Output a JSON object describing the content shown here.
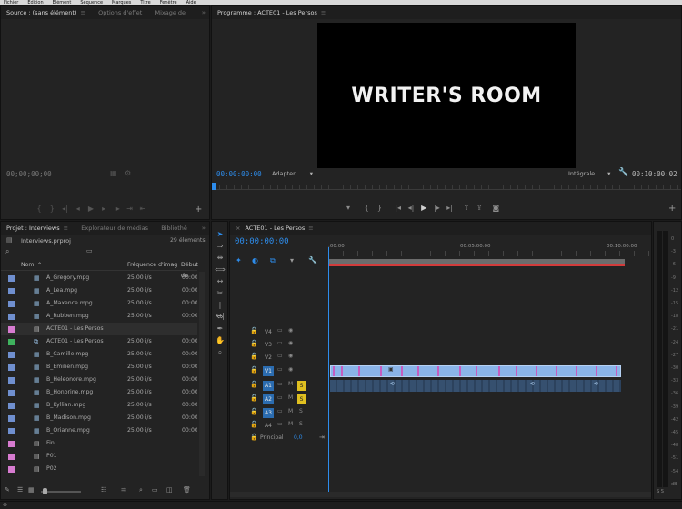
{
  "menubar": [
    "Fichier",
    "Édition",
    "Élément",
    "Séquence",
    "Marques",
    "Titre",
    "Fenêtre",
    "Aide"
  ],
  "source": {
    "tabs": [
      "Source : (sans élément)",
      "Options d'effet",
      "Mixage de"
    ],
    "timecode": "00;00;00;00"
  },
  "program": {
    "tab": "Programme : ACTE01 - Les Persos",
    "frame_text": "WRITER'S ROOM",
    "timecode": "00:00:00:00",
    "fit": "Adapter",
    "quality": "Intégrale",
    "duration": "00:10:00:02"
  },
  "project": {
    "tabs": [
      "Projet : Interviews",
      "Explorateur de médias",
      "Bibliothè"
    ],
    "filename": "Interviews.prproj",
    "count": "29 éléments",
    "columns": [
      "Nom",
      "Fréquence d'imag",
      "Début du"
    ],
    "rows": [
      {
        "name": "A_Gregory.mpg",
        "fps": "25,00 i/s",
        "start": "00:00",
        "color": "#6f8fcf",
        "icon": "clip"
      },
      {
        "name": "A_Lea.mpg",
        "fps": "25,00 i/s",
        "start": "00:00",
        "color": "#6f8fcf",
        "icon": "clip"
      },
      {
        "name": "A_Maxence.mpg",
        "fps": "25,00 i/s",
        "start": "00:00",
        "color": "#6f8fcf",
        "icon": "clip"
      },
      {
        "name": "A_Rubben.mpg",
        "fps": "25,00 i/s",
        "start": "00:00",
        "color": "#6f8fcf",
        "icon": "clip"
      },
      {
        "name": "ACTE01 - Les Persos",
        "fps": "",
        "start": "",
        "color": "#d77bd0",
        "icon": "doc"
      },
      {
        "name": "ACTE01 - Les Persos",
        "fps": "25,00 i/s",
        "start": "00:00",
        "color": "#3fb25e",
        "icon": "seq"
      },
      {
        "name": "B_Camille.mpg",
        "fps": "25,00 i/s",
        "start": "00:00",
        "color": "#6f8fcf",
        "icon": "clip"
      },
      {
        "name": "B_Emilien.mpg",
        "fps": "25,00 i/s",
        "start": "00:00",
        "color": "#6f8fcf",
        "icon": "clip"
      },
      {
        "name": "B_Heleonore.mpg",
        "fps": "25,00 i/s",
        "start": "00:00",
        "color": "#6f8fcf",
        "icon": "clip"
      },
      {
        "name": "B_Honorine.mpg",
        "fps": "25,00 i/s",
        "start": "00:00",
        "color": "#6f8fcf",
        "icon": "clip"
      },
      {
        "name": "B_Kyllian.mpg",
        "fps": "25,00 i/s",
        "start": "00:00",
        "color": "#6f8fcf",
        "icon": "clip"
      },
      {
        "name": "B_Madison.mpg",
        "fps": "25,00 i/s",
        "start": "00:00",
        "color": "#6f8fcf",
        "icon": "clip"
      },
      {
        "name": "B_Orianne.mpg",
        "fps": "25,00 i/s",
        "start": "00:00",
        "color": "#6f8fcf",
        "icon": "clip"
      },
      {
        "name": "Fin",
        "fps": "",
        "start": "",
        "color": "#d77bd0",
        "icon": "doc"
      },
      {
        "name": "P01",
        "fps": "",
        "start": "",
        "color": "#d77bd0",
        "icon": "doc"
      },
      {
        "name": "P02",
        "fps": "",
        "start": "",
        "color": "#d77bd0",
        "icon": "doc"
      }
    ]
  },
  "timeline": {
    "tab": "ACTE01 - Les Persos",
    "timecode": "00:00:00:00",
    "ruler": [
      ":00:00",
      "00:05:00:00",
      "00:10:00:00"
    ],
    "tracks": [
      "V4",
      "V3",
      "V2",
      "V1",
      "A1",
      "A2",
      "A3",
      "A4"
    ],
    "master": "Principal",
    "master_val": "0,0",
    "m": "M",
    "s": "S"
  },
  "meter": {
    "labels": [
      "0",
      "-3",
      "-6",
      "-9",
      "-12",
      "-15",
      "-18",
      "-21",
      "-24",
      "-27",
      "-30",
      "-33",
      "-36",
      "-39",
      "-42",
      "-45",
      "-48",
      "-51",
      "-54",
      "dB"
    ],
    "footer": "S S"
  },
  "colors": {
    "accent_blue": "#2d8ceb",
    "clip_video": "#8ab4e8",
    "clip_audio": "#36506f",
    "solo_yellow": "#e0c020",
    "label_pink": "#d77bd0"
  }
}
